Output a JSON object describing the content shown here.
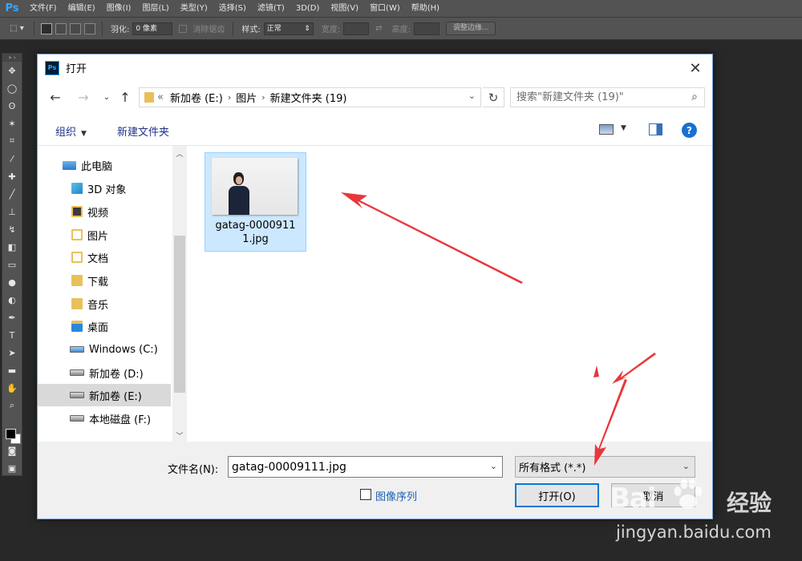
{
  "photoshop": {
    "logo": "Ps",
    "menu": [
      "文件(F)",
      "编辑(E)",
      "图像(I)",
      "图层(L)",
      "类型(Y)",
      "选择(S)",
      "滤镜(T)",
      "3D(D)",
      "视图(V)",
      "窗口(W)",
      "帮助(H)"
    ],
    "options": {
      "feather_label": "羽化:",
      "feather_value": "0 像素",
      "antialias_label": "消除锯齿",
      "style_label": "样式:",
      "style_value": "正常",
      "width_label": "宽度:",
      "height_label": "高度:",
      "refine_edge_label": "调整边缘..."
    }
  },
  "dialog": {
    "title": "打开",
    "title_icon": "Ps",
    "address": {
      "overflow": "«",
      "segments": [
        "新加卷 (E:)",
        "图片",
        "新建文件夹 (19)"
      ]
    },
    "search_placeholder": "搜索\"新建文件夹 (19)\"",
    "toolbar": {
      "organize": "组织",
      "new_folder": "新建文件夹"
    },
    "tree": [
      {
        "label": "此电脑",
        "icon": "computer-icon"
      },
      {
        "label": "3D 对象",
        "icon": "3d-objects-icon"
      },
      {
        "label": "视频",
        "icon": "videos-folder-icon"
      },
      {
        "label": "图片",
        "icon": "pictures-folder-icon"
      },
      {
        "label": "文档",
        "icon": "documents-folder-icon"
      },
      {
        "label": "下载",
        "icon": "downloads-folder-icon"
      },
      {
        "label": "音乐",
        "icon": "music-folder-icon"
      },
      {
        "label": "桌面",
        "icon": "desktop-folder-icon"
      },
      {
        "label": "Windows (C:)",
        "icon": "windows-drive-icon"
      },
      {
        "label": "新加卷 (D:)",
        "icon": "drive-icon"
      },
      {
        "label": "新加卷 (E:)",
        "icon": "drive-icon",
        "selected": true
      },
      {
        "label": "本地磁盘 (F:)",
        "icon": "drive-icon"
      }
    ],
    "files": [
      {
        "name_line1": "gatag-0000911",
        "name_line2": "1.jpg",
        "selected": true
      }
    ],
    "filename_label": "文件名(N):",
    "filename_value": "gatag-00009111.jpg",
    "filetype_value": "所有格式 (*.*)",
    "image_sequence_label": "图像序列",
    "open_button": "打开(O)",
    "cancel_button": "取消"
  },
  "watermark": {
    "brand_part1": "Bai",
    "brand_part2": "du",
    "brand_jingyan": "经验",
    "url": "jingyan.baidu.com"
  },
  "colors": {
    "ps_blue": "#31a8ff",
    "selection": "#cce8ff",
    "accent": "#0078d7",
    "annotation_red": "#e8373b"
  }
}
